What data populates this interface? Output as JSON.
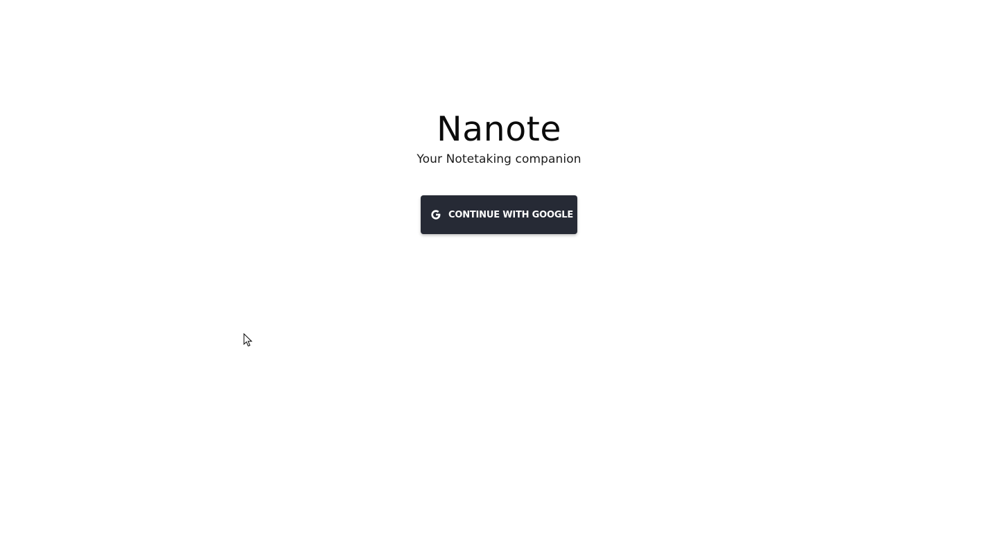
{
  "app": {
    "title": "Nanote",
    "tagline": "Your Notetaking companion"
  },
  "login": {
    "button_label": "CONTINUE WITH GOOGLE",
    "button_icon": "google-icon",
    "button_color": "#262a35"
  }
}
